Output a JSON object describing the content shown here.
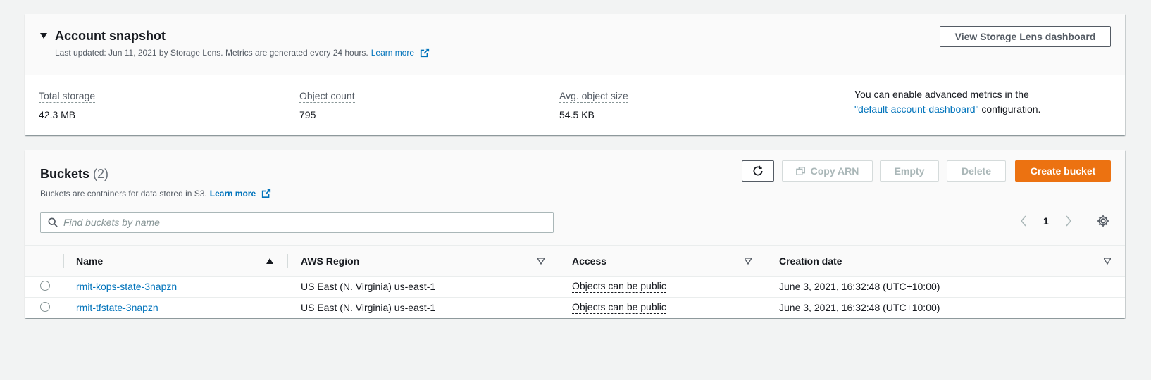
{
  "snapshot": {
    "title": "Account snapshot",
    "subtitle": "Last updated: Jun 11, 2021 by Storage Lens. Metrics are generated every 24 hours.",
    "learn_more": "Learn more",
    "view_button": "View Storage Lens dashboard",
    "metrics": [
      {
        "label": "Total storage",
        "value": "42.3 MB"
      },
      {
        "label": "Object count",
        "value": "795"
      },
      {
        "label": "Avg. object size",
        "value": "54.5 KB"
      }
    ],
    "advanced_note_prefix": "You can enable advanced metrics in the",
    "advanced_note_link": "\"default-account-dashboard\"",
    "advanced_note_suffix": "configuration."
  },
  "buckets": {
    "title": "Buckets",
    "count": "(2)",
    "subtitle": "Buckets are containers for data stored in S3.",
    "learn_more": "Learn more",
    "buttons": {
      "copy_arn": "Copy ARN",
      "empty": "Empty",
      "delete": "Delete",
      "create": "Create bucket"
    },
    "search_placeholder": "Find buckets by name",
    "page": "1",
    "columns": [
      "Name",
      "AWS Region",
      "Access",
      "Creation date"
    ],
    "rows": [
      {
        "name": "rmit-kops-state-3napzn",
        "region": "US East (N. Virginia) us-east-1",
        "access": "Objects can be public",
        "created": "June 3, 2021, 16:32:48 (UTC+10:00)"
      },
      {
        "name": "rmit-tfstate-3napzn",
        "region": "US East (N. Virginia) us-east-1",
        "access": "Objects can be public",
        "created": "June 3, 2021, 16:32:48 (UTC+10:00)"
      }
    ]
  },
  "colors": {
    "accent": "#ec7211",
    "link": "#0073bb"
  },
  "icons": [
    "caret-down-icon",
    "external-link-icon",
    "refresh-icon",
    "copy-icon",
    "search-icon",
    "chevron-left-icon",
    "chevron-right-icon",
    "settings-gear-icon",
    "sort-ascending-icon",
    "sort-descending-icon"
  ]
}
